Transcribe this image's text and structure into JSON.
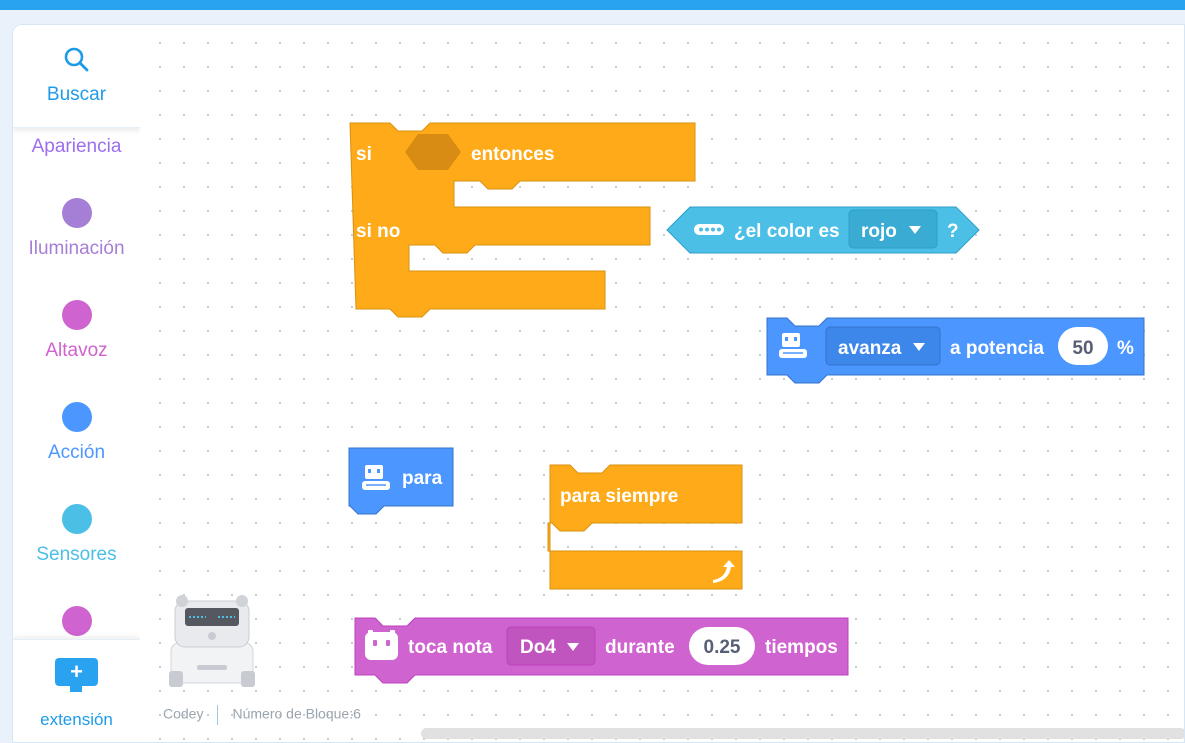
{
  "sidebar": {
    "search_label": "Buscar",
    "categories": [
      {
        "label": "Apariencia",
        "color": "#9d6ef0"
      },
      {
        "label": "Iluminación",
        "color": "#a57fd6"
      },
      {
        "label": "Altavoz",
        "color": "#cf63cf"
      },
      {
        "label": "Acción",
        "color": "#4c97ff"
      },
      {
        "label": "Sensores",
        "color": "#4cbfe6"
      },
      {
        "label": "",
        "color": "#cf63cf"
      }
    ],
    "extension_label": "extensión",
    "extension_icon": "+"
  },
  "blocks": {
    "if_else": {
      "if_label": "si",
      "then_label": "entonces",
      "else_label": "si no",
      "color": "#ffab19"
    },
    "color_sensor": {
      "label": "¿el color es",
      "dropdown": "rojo",
      "suffix": "?",
      "color": "#4cbfe6"
    },
    "move": {
      "dropdown": "avanza",
      "label": "a potencia",
      "value": "50",
      "suffix": "%",
      "color": "#4c97ff"
    },
    "stop": {
      "label": "para",
      "color": "#4c97ff"
    },
    "forever": {
      "label": "para siempre",
      "color": "#ffab19"
    },
    "play_note": {
      "label": "toca nota",
      "note": "Do4",
      "during_label": "durante",
      "beats": "0.25",
      "beats_label": "tiempos",
      "color": "#cf63cf"
    }
  },
  "status": {
    "device": "Codey",
    "block_count": "Número de Bloque:6"
  }
}
